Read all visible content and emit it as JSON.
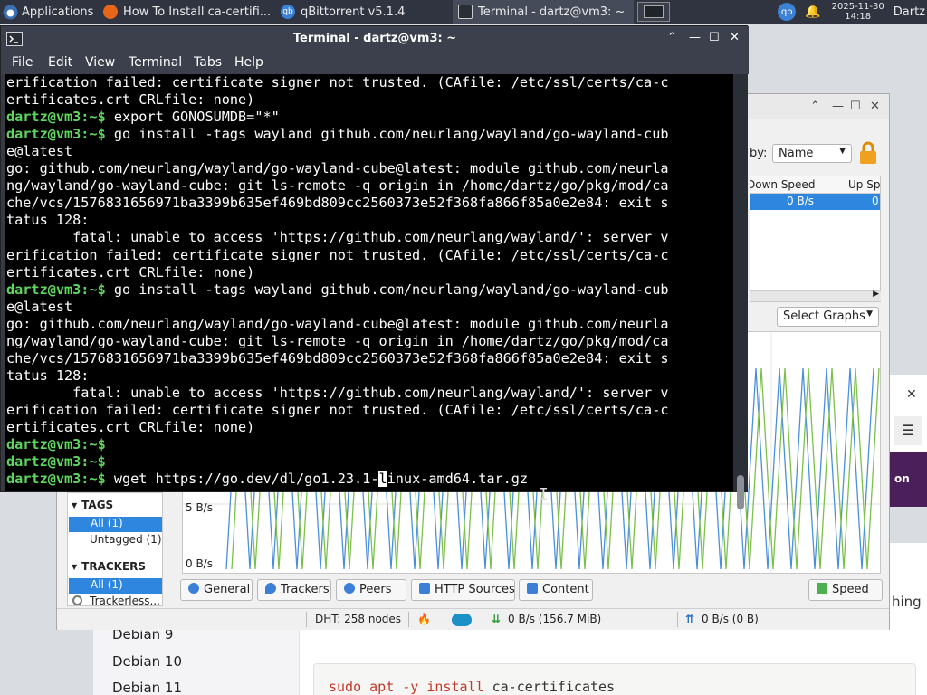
{
  "taskbar": {
    "apps_label": "Applications",
    "tasks": [
      {
        "label": "How To Install ca-certifi..."
      },
      {
        "label": "qBittorrent v5.1.4"
      },
      {
        "label": "Terminal - dartz@vm3: ~"
      }
    ],
    "date": "2025-11-30",
    "time": "14:18",
    "user": "Dartz"
  },
  "web": {
    "sidebar_items": [
      "Debian 9",
      "Debian 10",
      "Debian 11"
    ],
    "code_keyword": "sudo apt -y install",
    "code_arg": "ca-certificates",
    "cut_text_right": "on",
    "cut_text_bing": "hing"
  },
  "qbittorrent": {
    "sort_label": "by:",
    "sort_value": "Name",
    "columns": [
      "Down Speed",
      "Up Sp"
    ],
    "row": {
      "down_speed": "0 B/s",
      "up_speed": "0"
    },
    "graph_select": "Select Graphs",
    "graph_labels": [
      "5 B/s",
      "0 B/s"
    ],
    "sidebar": {
      "tags_header": "TAGS",
      "tags": [
        "All (1)",
        "Untagged (1)"
      ],
      "trackers_header": "TRACKERS",
      "trackers": [
        "All (1)",
        "Trackerless..."
      ]
    },
    "tabs": [
      "General",
      "Trackers",
      "Peers",
      "HTTP Sources",
      "Content"
    ],
    "speed_tab": "Speed",
    "status": {
      "dht": "DHT: 258 nodes",
      "down": "0 B/s (156.7 MiB)",
      "up": "0 B/s (0 B)"
    }
  },
  "terminal": {
    "title": "Terminal - dartz@vm3: ~",
    "menu": [
      "File",
      "Edit",
      "View",
      "Terminal",
      "Tabs",
      "Help"
    ],
    "prompt": "dartz@vm3",
    "lines": [
      {
        "type": "out",
        "text": "erification failed: certificate signer not trusted. (CAfile: /etc/ssl/certs/ca-c"
      },
      {
        "type": "out",
        "text": "ertificates.crt CRLfile: none)"
      },
      {
        "type": "cmd",
        "text": "export GONOSUMDB=\"*\""
      },
      {
        "type": "cmd",
        "text": "go install -tags wayland github.com/neurlang/wayland/go-wayland-cub"
      },
      {
        "type": "out",
        "text": "e@latest"
      },
      {
        "type": "out",
        "text": "go: github.com/neurlang/wayland/go-wayland-cube@latest: module github.com/neurla"
      },
      {
        "type": "out",
        "text": "ng/wayland/go-wayland-cube: git ls-remote -q origin in /home/dartz/go/pkg/mod/ca"
      },
      {
        "type": "out",
        "text": "che/vcs/1576831656971ba3399b635ef469bd809cc2560373e52f368fa866f85a0e2e84: exit s"
      },
      {
        "type": "out",
        "text": "tatus 128:"
      },
      {
        "type": "out",
        "text": "        fatal: unable to access 'https://github.com/neurlang/wayland/': server v"
      },
      {
        "type": "out",
        "text": "erification failed: certificate signer not trusted. (CAfile: /etc/ssl/certs/ca-c"
      },
      {
        "type": "out",
        "text": "ertificates.crt CRLfile: none)"
      },
      {
        "type": "cmd",
        "text": "go install -tags wayland github.com/neurlang/wayland/go-wayland-cub"
      },
      {
        "type": "out",
        "text": "e@latest"
      },
      {
        "type": "out",
        "text": "go: github.com/neurlang/wayland/go-wayland-cube@latest: module github.com/neurla"
      },
      {
        "type": "out",
        "text": "ng/wayland/go-wayland-cube: git ls-remote -q origin in /home/dartz/go/pkg/mod/ca"
      },
      {
        "type": "out",
        "text": "che/vcs/1576831656971ba3399b635ef469bd809cc2560373e52f368fa866f85a0e2e84: exit s"
      },
      {
        "type": "out",
        "text": "tatus 128:"
      },
      {
        "type": "out",
        "text": "        fatal: unable to access 'https://github.com/neurlang/wayland/': server v"
      },
      {
        "type": "out",
        "text": "erification failed: certificate signer not trusted. (CAfile: /etc/ssl/certs/ca-c"
      },
      {
        "type": "out",
        "text": "ertificates.crt CRLfile: none)"
      },
      {
        "type": "cmd",
        "text": ""
      },
      {
        "type": "cmd",
        "text": ""
      }
    ],
    "current_command": {
      "before_cursor": "wget https://go.dev/dl/go1.23.1-",
      "cursor_char": "l",
      "after_cursor": "inux-amd64.tar.gz"
    }
  },
  "colors": {
    "prompt_green": "#5fd75f",
    "selection_blue": "#2e86de",
    "graph_blue": "#4a90d9",
    "graph_green": "#7cc04b",
    "terminal_bg": "#000000"
  }
}
